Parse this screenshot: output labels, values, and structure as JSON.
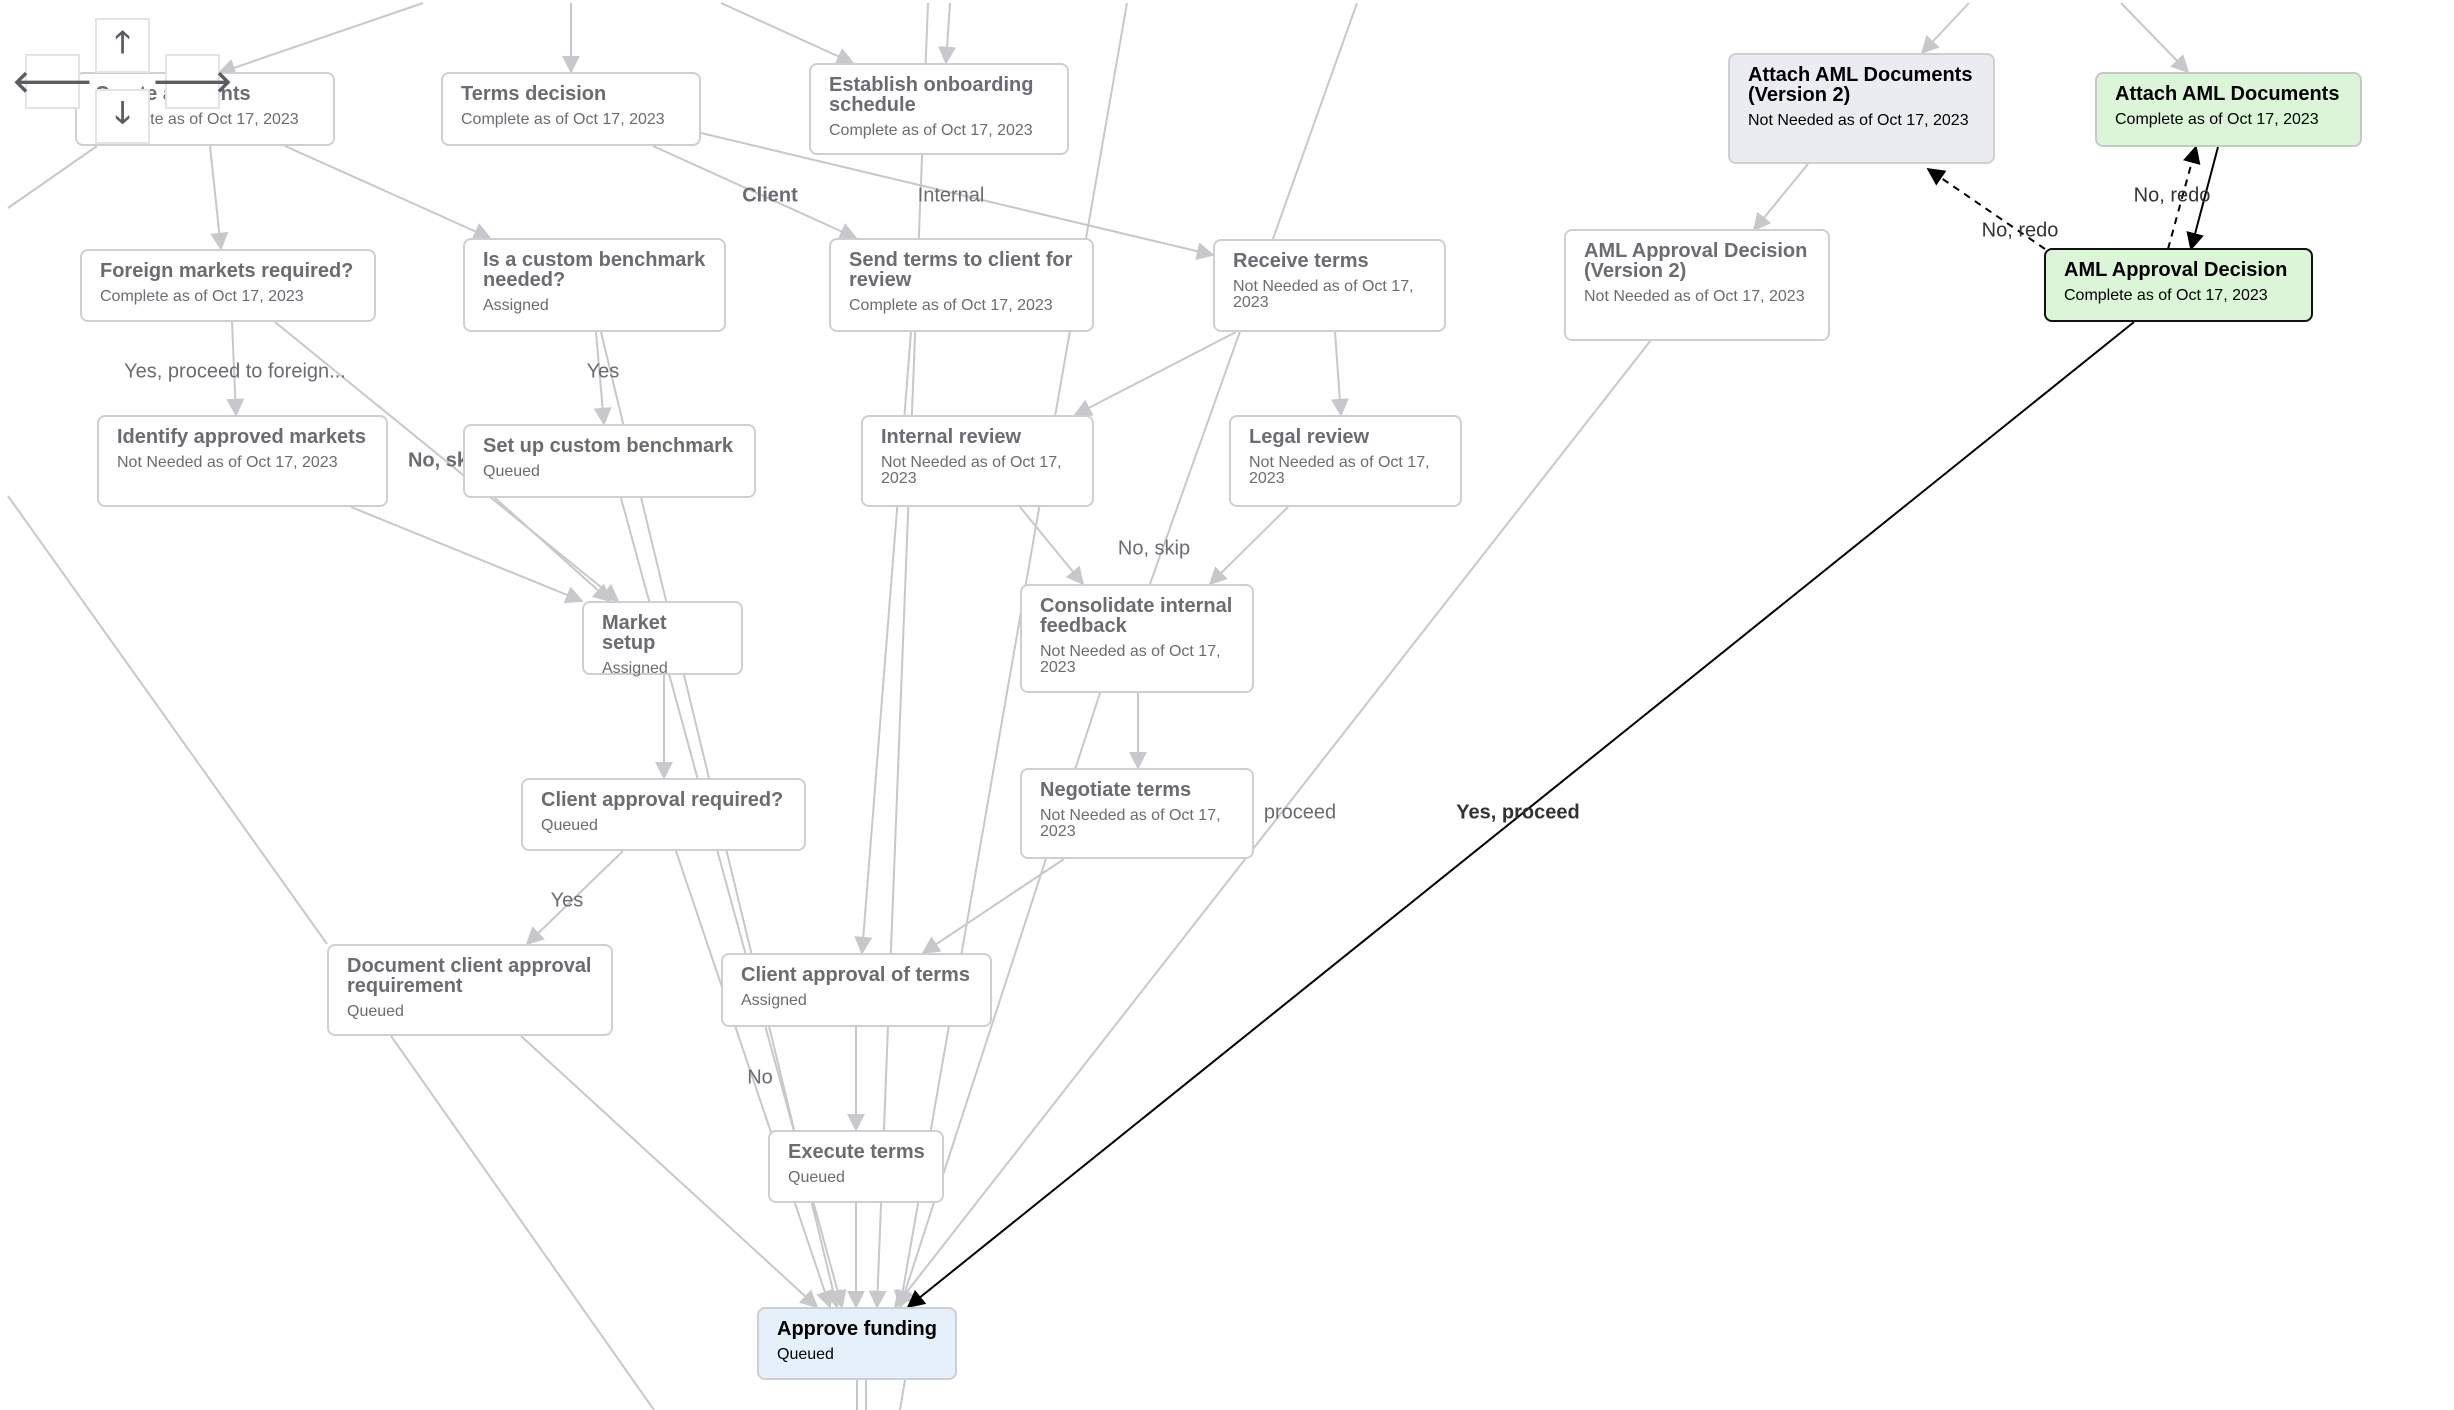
{
  "nav": {
    "up": "🡑",
    "down": "🡓",
    "left": "🡐",
    "right": "🡒",
    "up_icon": "arrow-up-icon",
    "down_icon": "arrow-down-icon",
    "left_icon": "arrow-left-icon",
    "right_icon": "arrow-right-icon"
  },
  "colors": {
    "edge_inactive": "#c8c8cc",
    "edge_active": "#000000",
    "node_complete_fill": "#dcf5d8",
    "node_next_fill": "#e6f0fa",
    "node_skipped_fill": "#ebecf0"
  },
  "nodes": [
    {
      "id": "create_accounts",
      "title": "Create accounts",
      "status": "Complete as of Oct 17, 2023",
      "state": "faded"
    },
    {
      "id": "terms_decision",
      "title": "Terms decision",
      "status": "Complete as of Oct 17, 2023",
      "state": "faded"
    },
    {
      "id": "establish_onboarding",
      "title": "Establish onboarding schedule",
      "status": "Complete as of Oct 17, 2023",
      "state": "faded"
    },
    {
      "id": "attach_aml_v2",
      "title": "Attach AML Documents (Version 2)",
      "status": "Not Needed as of Oct 17, 2023",
      "state": "skipped"
    },
    {
      "id": "attach_aml",
      "title": "Attach AML Documents",
      "status": "Complete as of Oct 17, 2023",
      "state": "complete"
    },
    {
      "id": "foreign_markets",
      "title": "Foreign markets required?",
      "status": "Complete as of Oct 17, 2023",
      "state": "faded"
    },
    {
      "id": "custom_benchmark_q",
      "title": "Is a custom benchmark needed?",
      "status": "Assigned",
      "state": "faded"
    },
    {
      "id": "send_terms",
      "title": "Send terms to client for review",
      "status": "Complete as of Oct 17, 2023",
      "state": "faded"
    },
    {
      "id": "receive_terms",
      "title": "Receive terms",
      "status": "Not Needed as of Oct 17, 2023",
      "state": "faded"
    },
    {
      "id": "aml_decision_v2",
      "title": "AML Approval Decision (Version 2)",
      "status": "Not Needed as of Oct 17, 2023",
      "state": "faded"
    },
    {
      "id": "aml_decision",
      "title": "AML Approval Decision",
      "status": "Complete as of Oct 17, 2023",
      "state": "complete-selected"
    },
    {
      "id": "identify_markets",
      "title": "Identify approved markets",
      "status": "Not Needed as of Oct 17, 2023",
      "state": "faded"
    },
    {
      "id": "setup_benchmark",
      "title": "Set up custom benchmark",
      "status": "Queued",
      "state": "faded"
    },
    {
      "id": "internal_review",
      "title": "Internal review",
      "status": "Not Needed as of Oct 17, 2023",
      "state": "faded"
    },
    {
      "id": "legal_review",
      "title": "Legal review",
      "status": "Not Needed as of Oct 17, 2023",
      "state": "faded"
    },
    {
      "id": "market_setup",
      "title": "Market setup",
      "status": "Assigned",
      "state": "faded"
    },
    {
      "id": "consolidate_feedback",
      "title": "Consolidate internal feedback",
      "status": "Not Needed as of Oct 17, 2023",
      "state": "faded"
    },
    {
      "id": "client_approval_q",
      "title": "Client approval required?",
      "status": "Queued",
      "state": "faded"
    },
    {
      "id": "negotiate_terms",
      "title": "Negotiate terms",
      "status": "Not Needed as of Oct 17, 2023",
      "state": "faded"
    },
    {
      "id": "document_client_approval",
      "title": "Document client approval requirement",
      "status": "Queued",
      "state": "faded"
    },
    {
      "id": "client_approval_terms",
      "title": "Client approval of terms",
      "status": "Assigned",
      "state": "faded"
    },
    {
      "id": "execute_terms",
      "title": "Execute terms",
      "status": "Queued",
      "state": "faded"
    },
    {
      "id": "approve_funding",
      "title": "Approve funding",
      "status": "Queued",
      "state": "next"
    }
  ],
  "edge_labels": [
    {
      "text": "Client",
      "style": "bold"
    },
    {
      "text": "Internal",
      "style": "normal"
    },
    {
      "text": "Yes, proceed to foreign...",
      "style": "normal"
    },
    {
      "text": "No, sk",
      "style": "bold"
    },
    {
      "text": "Yes",
      "style": "normal"
    },
    {
      "text": "No, skip",
      "style": "normal"
    },
    {
      "text": "proceed",
      "style": "normal"
    },
    {
      "text": "Yes, proceed",
      "style": "bold-active"
    },
    {
      "text": "Yes",
      "style": "normal"
    },
    {
      "text": "No",
      "style": "normal"
    },
    {
      "text": "No, redo",
      "style": "active"
    },
    {
      "text": "No, redo",
      "style": "active"
    }
  ]
}
